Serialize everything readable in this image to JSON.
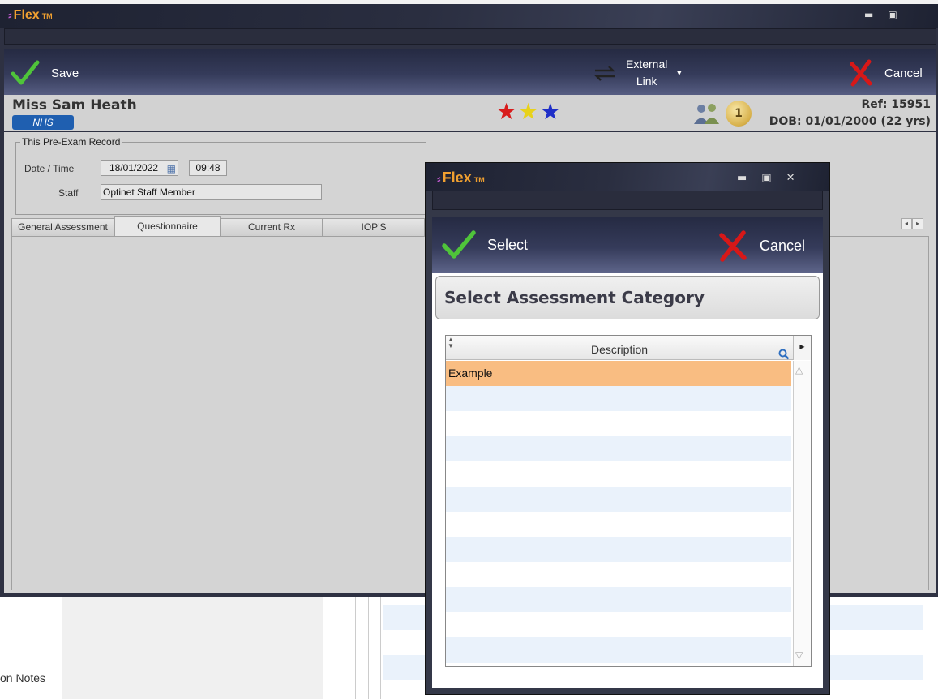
{
  "background": {
    "notes_label": "on Notes"
  },
  "window": {
    "app_name": "Flex",
    "app_tm": "TM",
    "minimize_icon": "minimize-icon",
    "maximize_icon": "maximize-icon"
  },
  "toolbar": {
    "save_label": "Save",
    "external_link_line1": "External",
    "external_link_line2": "Link",
    "cancel_label": "Cancel"
  },
  "patient": {
    "name": "Miss Sam Heath",
    "badge": "NHS",
    "ref": "Ref: 15951",
    "dob": "DOB: 01/01/2000 (22 yrs)",
    "coin_value": "1",
    "star_colors": [
      "#d81c1c",
      "#e8d21a",
      "#1f2fc8"
    ]
  },
  "record": {
    "legend": "This Pre-Exam Record",
    "date_time_label": "Date / Time",
    "date_value": "18/01/2022",
    "time_value": "09:48",
    "staff_label": "Staff",
    "staff_value": "Optinet Staff Member"
  },
  "tabs": [
    "General Assessment",
    "Questionnaire",
    "Current Rx",
    "IOP'S"
  ],
  "active_tab": "Questionnaire",
  "dialog": {
    "app_name": "Flex",
    "app_tm": "TM",
    "select_label": "Select",
    "cancel_label": "Cancel",
    "heading": "Select Assessment Category",
    "column_header": "Description",
    "rows": [
      "Example",
      "",
      "",
      "",
      "",
      "",
      "",
      "",
      "",
      "",
      "",
      "",
      ""
    ],
    "selected_row": 0
  },
  "colors": {
    "accent_orange": "#f0a030",
    "selection": "#f9bd82",
    "row_alt": "#eaf2fb",
    "nhs_blue": "#1f5fb0"
  }
}
